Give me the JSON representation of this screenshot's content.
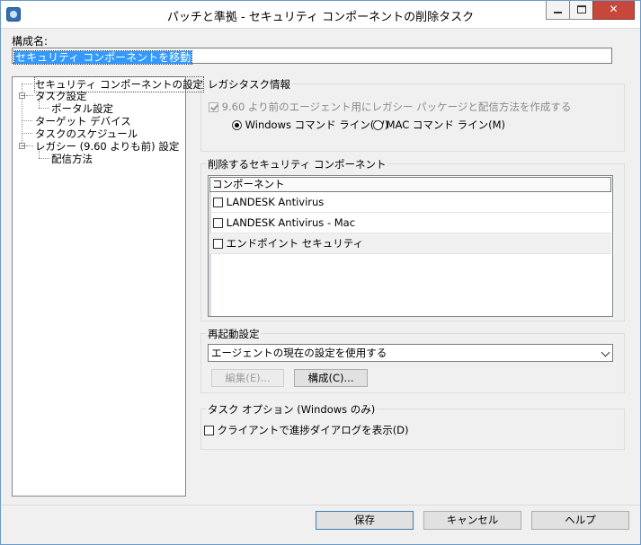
{
  "window": {
    "title": "パッチと準拠 - セキュリティ コンポーネントの削除タスク",
    "minimize_glyph": "",
    "maximize_glyph": "",
    "close_glyph": "✕"
  },
  "config": {
    "label": "構成名:",
    "value": "セキュリティ コンポーネントを移動"
  },
  "tree": {
    "items": [
      {
        "label": "セキュリティ コンポーネントの設定"
      },
      {
        "label": "タスク設定"
      },
      {
        "label": "ポータル設定"
      },
      {
        "label": "ターゲット デバイス"
      },
      {
        "label": "タスクのスケジュール"
      },
      {
        "label": "レガシー (9.60 よりも前) 設定"
      },
      {
        "label": "配信方法"
      }
    ]
  },
  "legacy": {
    "title": "レガシタスク情報",
    "checkbox_label": "9.60 より前のエージェント用にレガシー パッケージと配信方法を作成する",
    "radio_windows": "Windows コマンド ライン(W)",
    "radio_mac": "MAC コマンド ライン(M)"
  },
  "components": {
    "title": "削除するセキュリティ コンポーネント",
    "column_header": "コンポーネント",
    "rows": [
      {
        "label": "LANDESK Antivirus"
      },
      {
        "label": "LANDESK Antivirus - Mac"
      },
      {
        "label": "エンドポイント セキュリティ"
      }
    ]
  },
  "reboot": {
    "title": "再起動設定",
    "selected": "エージェントの現在の設定を使用する",
    "edit_button": "編集(E)...",
    "configure_button": "構成(C)..."
  },
  "task_options": {
    "title": "タスク オプション (Windows のみ)",
    "checkbox_label": "クライアントで進捗ダイアログを表示(D)"
  },
  "footer": {
    "save": "保存",
    "cancel": "キャンセル",
    "help": "ヘルプ"
  }
}
